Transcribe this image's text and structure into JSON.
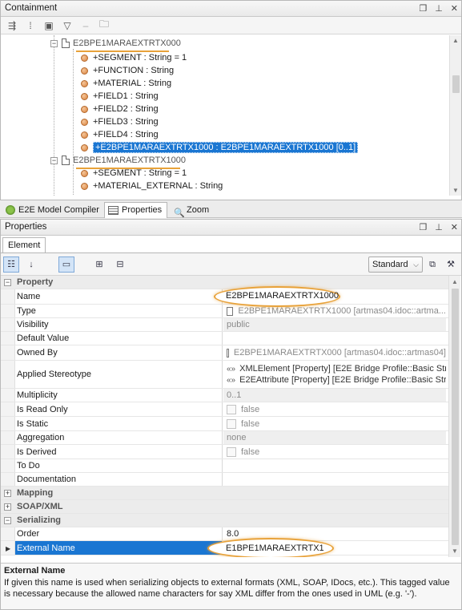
{
  "containment": {
    "title": "Containment",
    "toolbar_icons": [
      "expand-icon",
      "collapse-icon",
      "group-icon",
      "filter-icon",
      "dropdown-icon",
      "folder-icon"
    ],
    "tree": [
      {
        "kind": "class",
        "label": "E2BPE1MARAEXTRTX000",
        "indent": 1,
        "expanded": true
      },
      {
        "kind": "attr",
        "label": "+SEGMENT : String = 1",
        "indent": 2
      },
      {
        "kind": "attr",
        "label": "+FUNCTION : String",
        "indent": 2
      },
      {
        "kind": "attr",
        "label": "+MATERIAL : String",
        "indent": 2
      },
      {
        "kind": "attr",
        "label": "+FIELD1 : String",
        "indent": 2
      },
      {
        "kind": "attr",
        "label": "+FIELD2 : String",
        "indent": 2
      },
      {
        "kind": "attr",
        "label": "+FIELD3 : String",
        "indent": 2
      },
      {
        "kind": "attr",
        "label": "+FIELD4 : String",
        "indent": 2
      },
      {
        "kind": "attr",
        "label": "+E2BPE1MARAEXTRTX1000 : E2BPE1MARAEXTRTX1000 [0..1]",
        "indent": 2,
        "selected": true
      },
      {
        "kind": "class",
        "label": "E2BPE1MARAEXTRTX1000",
        "indent": 1,
        "expanded": true
      },
      {
        "kind": "attr",
        "label": "+SEGMENT : String = 1",
        "indent": 2
      },
      {
        "kind": "attr",
        "label": "+MATERIAL_EXTERNAL : String",
        "indent": 2
      }
    ]
  },
  "view_tabs": [
    {
      "label": "E2E Model Compiler",
      "icon": "compiler-icon",
      "active": false
    },
    {
      "label": "Properties",
      "icon": "properties-icon",
      "active": true
    },
    {
      "label": "Zoom",
      "icon": "zoom-icon",
      "active": false
    }
  ],
  "properties": {
    "title": "Properties",
    "element_tab": "Element",
    "mode": "Standard",
    "groups": {
      "property": "Property",
      "mapping": "Mapping",
      "soap": "SOAP/XML",
      "serializing": "Serializing"
    },
    "rows": {
      "name": {
        "label": "Name",
        "value": "E2BPE1MARAEXTRTX1000"
      },
      "type": {
        "label": "Type",
        "value": "E2BPE1MARAEXTRTX1000 [artmas04.idoc::artma..."
      },
      "visibility": {
        "label": "Visibility",
        "value": "public"
      },
      "default_value": {
        "label": "Default Value",
        "value": ""
      },
      "owned_by": {
        "label": "Owned By",
        "value": "E2BPE1MARAEXTRTX000 [artmas04.idoc::artmas04]"
      },
      "applied_stereotype": {
        "label": "Applied Stereotype",
        "value1": "XMLElement [Property] [E2E Bridge Profile::Basic Stru",
        "value2": "E2EAttribute [Property] [E2E Bridge Profile::Basic Str"
      },
      "multiplicity": {
        "label": "Multiplicity",
        "value": "0..1"
      },
      "is_read_only": {
        "label": "Is Read Only",
        "value": "false"
      },
      "is_static": {
        "label": "Is Static",
        "value": "false"
      },
      "aggregation": {
        "label": "Aggregation",
        "value": "none"
      },
      "is_derived": {
        "label": "Is Derived",
        "value": "false"
      },
      "to_do": {
        "label": "To Do",
        "value": ""
      },
      "documentation": {
        "label": "Documentation",
        "value": ""
      },
      "order": {
        "label": "Order",
        "value": "8.0"
      },
      "external_name": {
        "label": "External Name",
        "value": "E1BPE1MARAEXTRTX1"
      }
    },
    "description": {
      "title": "External Name",
      "text": "If given this name is used when serializing objects to external formats (XML, SOAP, IDocs, etc.). This tagged value is necessary because the allowed name characters for say XML differ from the ones used in UML (e.g. '-')."
    }
  }
}
